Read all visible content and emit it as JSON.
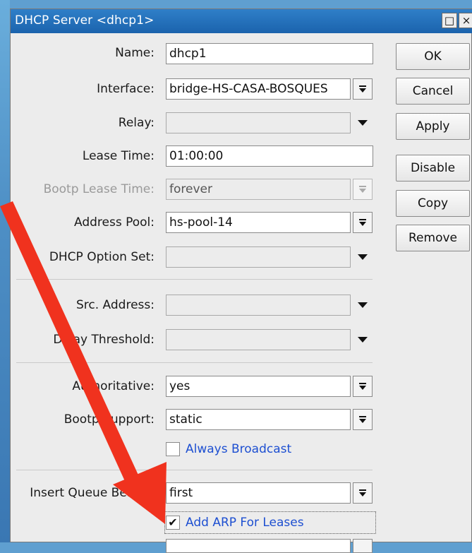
{
  "window": {
    "title": "DHCP Server <dhcp1>",
    "restore_icon": "□",
    "close_icon": "×"
  },
  "form": {
    "name": {
      "label": "Name:",
      "value": "dhcp1"
    },
    "interface": {
      "label": "Interface:",
      "value": "bridge-HS-CASA-BOSQUES"
    },
    "relay": {
      "label": "Relay:",
      "value": ""
    },
    "lease_time": {
      "label": "Lease Time:",
      "value": "01:00:00"
    },
    "bootp_lease_time": {
      "label": "Bootp Lease Time:",
      "value": "forever"
    },
    "address_pool": {
      "label": "Address Pool:",
      "value": "hs-pool-14"
    },
    "dhcp_option_set": {
      "label": "DHCP Option Set:",
      "value": ""
    },
    "src_address": {
      "label": "Src. Address:",
      "value": ""
    },
    "delay_threshold": {
      "label": "Delay Threshold:",
      "value": ""
    },
    "authoritative": {
      "label": "Authoritative:",
      "value": "yes"
    },
    "bootp_support": {
      "label": "Bootp Support:",
      "value": "static"
    },
    "always_broadcast": {
      "label": "Always Broadcast",
      "checked": false
    },
    "insert_queue_before": {
      "label": "Insert Queue Before:",
      "value": "first"
    },
    "add_arp_for_leases": {
      "label": "Add ARP For Leases",
      "checked": true
    }
  },
  "buttons": {
    "ok": "OK",
    "cancel": "Cancel",
    "apply": "Apply",
    "disable": "Disable",
    "copy": "Copy",
    "remove": "Remove"
  },
  "icons": {
    "dropdown_framed": "dropdown-framed-icon",
    "dropdown_plain": "dropdown-plain-icon",
    "annotation_arrow": "red-arrow-annotation",
    "check_mark": "✔"
  },
  "colors": {
    "titlebar": "#1f6bb5",
    "window_bg": "#ececec",
    "link_label": "#1d4fd1",
    "annotation_arrow": "#f0321e"
  }
}
